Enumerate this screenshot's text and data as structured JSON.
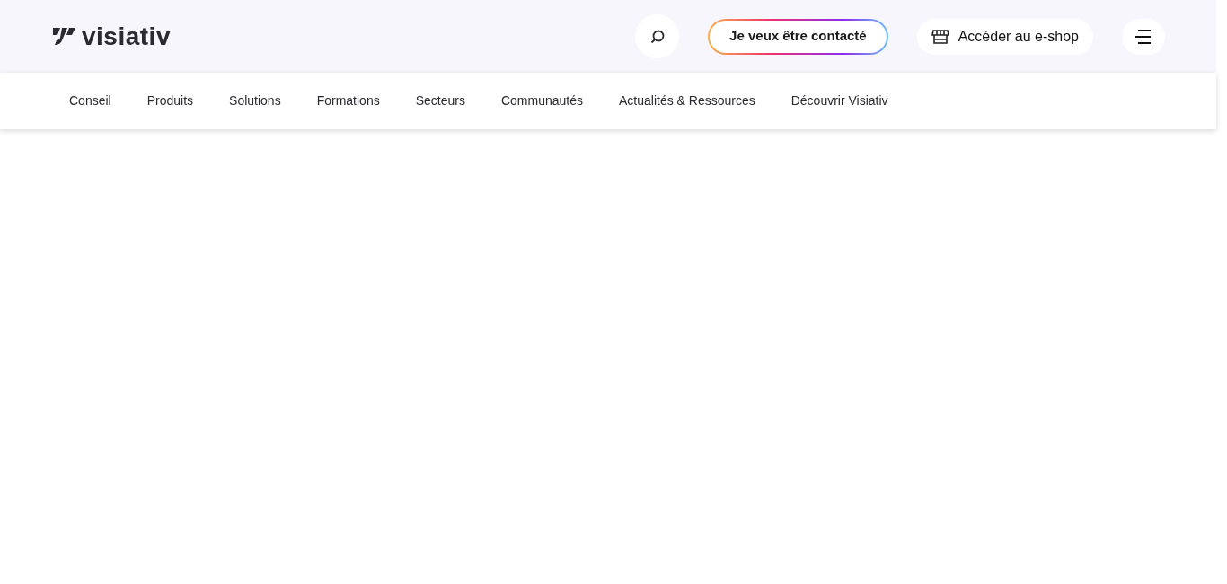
{
  "header": {
    "logo": "visiativ",
    "contact_button": "Je veux être contacté",
    "shop_button": "Accéder au e-shop"
  },
  "nav": [
    "Conseil",
    "Produits",
    "Solutions",
    "Formations",
    "Secteurs",
    "Communautés",
    "Actualités & Ressources",
    "Découvrir Visiativ"
  ]
}
